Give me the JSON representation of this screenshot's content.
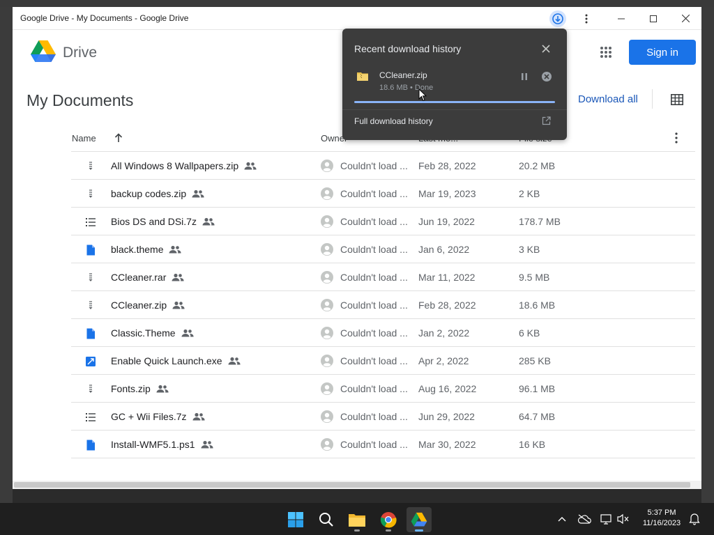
{
  "window": {
    "title": "Google Drive - My Documents - Google Drive"
  },
  "header": {
    "brand": "Drive",
    "sign_in": "Sign in"
  },
  "page": {
    "title": "My Documents",
    "download_all": "Download all"
  },
  "columns": {
    "name": "Name",
    "owner": "Owner",
    "last_modified": "Last mo...",
    "file_size": "File size"
  },
  "files": [
    {
      "name": "All Windows 8 Wallpapers.zip",
      "icon": "zip-icon",
      "owner": "Couldn't load ...",
      "modified": "Feb 28, 2022",
      "size": "20.2 MB"
    },
    {
      "name": "backup codes.zip",
      "icon": "zip-icon",
      "owner": "Couldn't load ...",
      "modified": "Mar 19, 2023",
      "size": "2 KB"
    },
    {
      "name": "Bios DS and DSi.7z",
      "icon": "list-icon",
      "owner": "Couldn't load ...",
      "modified": "Jun 19, 2022",
      "size": "178.7 MB"
    },
    {
      "name": "black.theme",
      "icon": "doc-icon",
      "owner": "Couldn't load ...",
      "modified": "Jan 6, 2022",
      "size": "3 KB"
    },
    {
      "name": "CCleaner.rar",
      "icon": "zip-icon",
      "owner": "Couldn't load ...",
      "modified": "Mar 11, 2022",
      "size": "9.5 MB"
    },
    {
      "name": "CCleaner.zip",
      "icon": "zip-icon",
      "owner": "Couldn't load ...",
      "modified": "Feb 28, 2022",
      "size": "18.6 MB"
    },
    {
      "name": "Classic.Theme",
      "icon": "doc-icon",
      "owner": "Couldn't load ...",
      "modified": "Jan 2, 2022",
      "size": "6 KB"
    },
    {
      "name": "Enable Quick Launch.exe",
      "icon": "exe-icon",
      "owner": "Couldn't load ...",
      "modified": "Apr 2, 2022",
      "size": "285 KB"
    },
    {
      "name": "Fonts.zip",
      "icon": "zip-icon",
      "owner": "Couldn't load ...",
      "modified": "Aug 16, 2022",
      "size": "96.1 MB"
    },
    {
      "name": "GC + Wii Files.7z",
      "icon": "list-icon",
      "owner": "Couldn't load ...",
      "modified": "Jun 29, 2022",
      "size": "64.7 MB"
    },
    {
      "name": "Install-WMF5.1.ps1",
      "icon": "doc-icon",
      "owner": "Couldn't load ...",
      "modified": "Mar 30, 2022",
      "size": "16 KB"
    }
  ],
  "download_popup": {
    "title": "Recent download history",
    "file_name": "CCleaner.zip",
    "status": "18.6 MB • Done",
    "progress": 1.0,
    "full_history": "Full download history"
  },
  "taskbar": {
    "apps": [
      "windows-start-icon",
      "search-icon",
      "file-explorer-icon",
      "chrome-icon",
      "google-drive-icon"
    ],
    "time": "5:37 PM",
    "date": "11/16/2023"
  },
  "colors": {
    "accent": "#1a73e8",
    "popup_bg": "#3c3c3c",
    "progress": "#8ab4f8"
  }
}
